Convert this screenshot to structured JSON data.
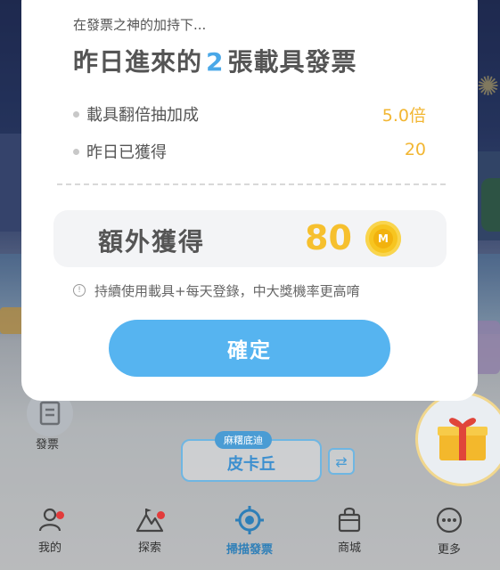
{
  "modal": {
    "subtitle": "在發票之神的加持下...",
    "headline_prefix": "昨日進來的",
    "headline_count": "2",
    "headline_suffix": "張載具發票",
    "rows": [
      {
        "label": "載具翻倍抽加成",
        "value": "5.0倍"
      },
      {
        "label": "昨日已獲得",
        "value": "20"
      }
    ],
    "bonus_label": "額外獲得",
    "bonus_value": "80",
    "coin_letter": "M",
    "note": "持續使用載具+每天登錄，中大獎機率更高唷",
    "confirm_label": "確定"
  },
  "home": {
    "receipt_label": "發票",
    "carrier_tag": "麻糬底迪",
    "carrier_name": "皮卡丘",
    "swap_icon": "⇄"
  },
  "nav": {
    "items": [
      {
        "label": "我的",
        "icon": "person-icon",
        "badge": true
      },
      {
        "label": "探索",
        "icon": "mountain-icon",
        "badge": true
      },
      {
        "label": "掃描發票",
        "icon": "scan-target-icon",
        "active": true
      },
      {
        "label": "商城",
        "icon": "shopping-bag-icon"
      },
      {
        "label": "更多",
        "icon": "more-dots-icon"
      }
    ]
  },
  "colors": {
    "accent_blue": "#56b4f0",
    "value_gold": "#f2b632",
    "active_nav": "#2e7fb8"
  }
}
